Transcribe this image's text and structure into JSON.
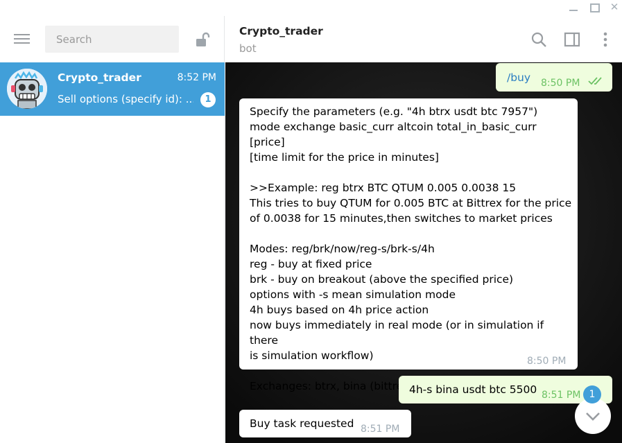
{
  "sidebar": {
    "search_placeholder": "Search",
    "chats": [
      {
        "name": "Crypto_trader",
        "time": "8:52 PM",
        "preview": "Sell options (specify id): ...",
        "unread": "1"
      }
    ]
  },
  "header": {
    "title": "Crypto_trader",
    "status": "bot"
  },
  "messages": [
    {
      "direction": "out",
      "text": "/buy",
      "time": "8:50 PM",
      "status": "read"
    },
    {
      "direction": "in",
      "text": "Specify the parameters (e.g. \"4h btrx usdt btc 7957\")\nmode exchange basic_curr altcoin total_in_basic_curr [price]\n[time limit for the price in minutes]\n\n>>Example: reg btrx BTC QTUM 0.005 0.0038 15\nThis tries to buy QTUM for 0.005 BTC at Bittrex for the price\nof 0.0038 for 15 minutes,then switches to market prices\n\nModes: reg/brk/now/reg-s/brk-s/4h\nreg - buy at fixed price\nbrk - buy on breakout (above the specified price)\noptions with -s mean simulation mode\n4h buys based on 4h price action\nnow buys immediately in real mode (or in simulation if there\nis simulation workflow)\n\nExchanges: btrx, bina (bittrex, binance)",
      "time": "8:50 PM"
    },
    {
      "direction": "out",
      "text": "4h-s bina usdt btc 5500",
      "time": "8:51 PM",
      "status": "read"
    },
    {
      "direction": "in",
      "text": "Buy task requested",
      "time": "8:51 PM"
    }
  ],
  "scroll_badge": "1",
  "colors": {
    "accent": "#419fd9",
    "outgoing_bubble": "#effdde",
    "incoming_bubble": "#ffffff",
    "chat_background": "#141414"
  },
  "icons": {
    "menu": "hamburger-icon",
    "lock": "unlock-icon",
    "header_search": "search-icon",
    "header_panel": "side-panel-icon",
    "header_more": "more-vertical-icon",
    "read_status": "double-check-icon",
    "scroll": "chevron-down-icon"
  }
}
